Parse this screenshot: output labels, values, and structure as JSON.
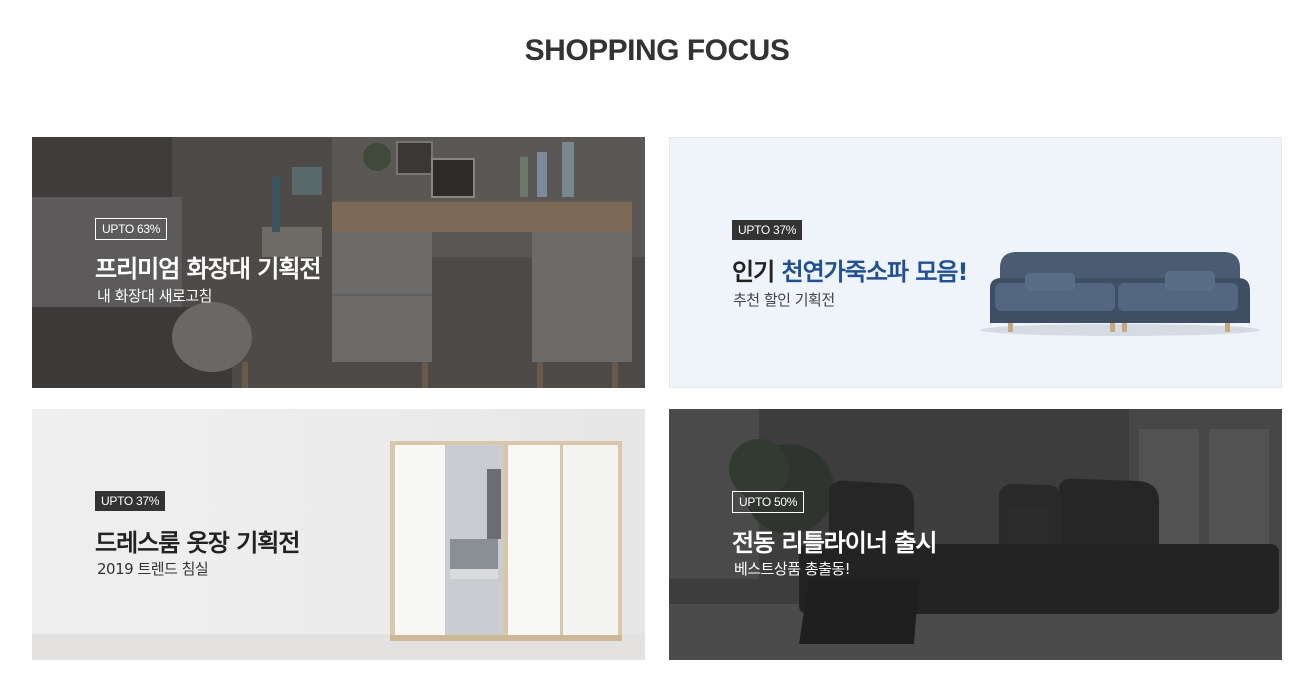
{
  "section": {
    "title": "SHOPPING FOCUS"
  },
  "banners": [
    {
      "badge": "UPTO 63%",
      "headline": "프리미엄 화장대 기획전",
      "subline": "내 화장대 새로고침"
    },
    {
      "badge": "UPTO 37%",
      "headline_lead": "인기 ",
      "headline_highlight": "천연가죽소파 모음!",
      "subline": "추천 할인 기획전"
    },
    {
      "badge": "UPTO 37%",
      "headline": "드레스룸 옷장 기획전",
      "subline": "2019 트렌드 침실"
    },
    {
      "badge": "UPTO 50%",
      "headline": "전동 리틀라이너 출시",
      "subline": "베스트상품 총출동!"
    }
  ],
  "colors": {
    "highlight": "#1f4f9c",
    "badge_dark": "#333333",
    "title": "#333333"
  }
}
